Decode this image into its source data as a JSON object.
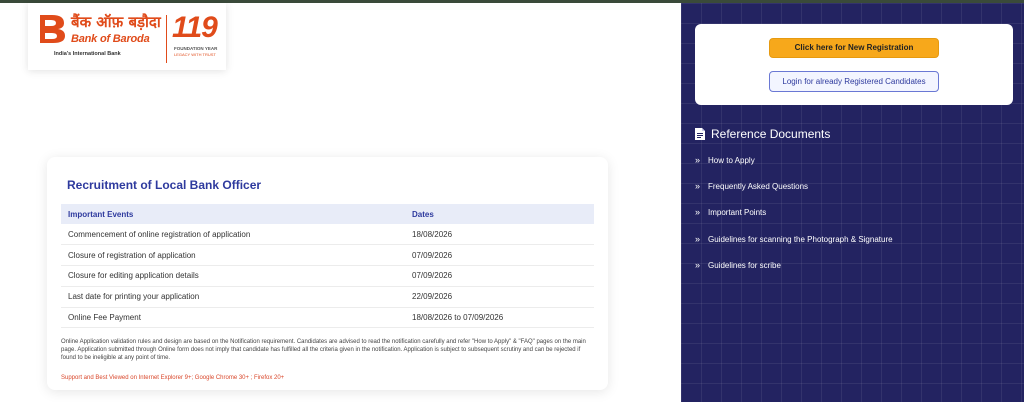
{
  "logo": {
    "hindi_name": "बैंक ऑफ़ बड़ौदा",
    "english_name": "Bank of Baroda",
    "tagline": "India's International Bank",
    "number": "119",
    "foundation": "FOUNDATION YEAR",
    "legacy": "LEGACY WITH TRUST",
    "brand_color": "#e04b1a"
  },
  "main": {
    "title": "Recruitment of Local Bank Officer",
    "table": {
      "headers": [
        "Important Events",
        "Dates"
      ],
      "rows": [
        {
          "event": "Commencement of online registration of application",
          "date": "18/08/2026"
        },
        {
          "event": "Closure of registration of application",
          "date": "07/09/2026"
        },
        {
          "event": "Closure for editing application details",
          "date": "07/09/2026"
        },
        {
          "event": "Last date for printing your application",
          "date": "22/09/2026"
        },
        {
          "event": "Online Fee Payment",
          "date": "18/08/2026 to 07/09/2026"
        }
      ]
    },
    "note": "Online Application validation rules and design are based on the Notification requirement. Candidates are advised to read the notification carefully and refer \"How to Apply\" & \"FAQ\" pages on the main page. Application submitted through Online form does not imply that candidate has fulfilled all the criteria given in the notification. Application is subject to subsequent scrutiny and can be rejected if found to be ineligible at any point of time.",
    "support": "Support and Best Viewed on Internet Explorer 9+; Google Chrome 30+ ; Firefox 20+"
  },
  "right": {
    "new_registration": "Click here for New Registration",
    "login": "Login for already Registered Candidates",
    "ref_title": "Reference Documents",
    "ref_icon": "document-icon",
    "ref_items": [
      {
        "label": "How to Apply"
      },
      {
        "label": "Frequently Asked Questions"
      },
      {
        "label": "Important Points"
      },
      {
        "label": "Guidelines for scanning the Photograph & Signature"
      },
      {
        "label": "Guidelines for scribe"
      }
    ],
    "panel_color": "#232361",
    "accent_button": "#f7a81b"
  }
}
